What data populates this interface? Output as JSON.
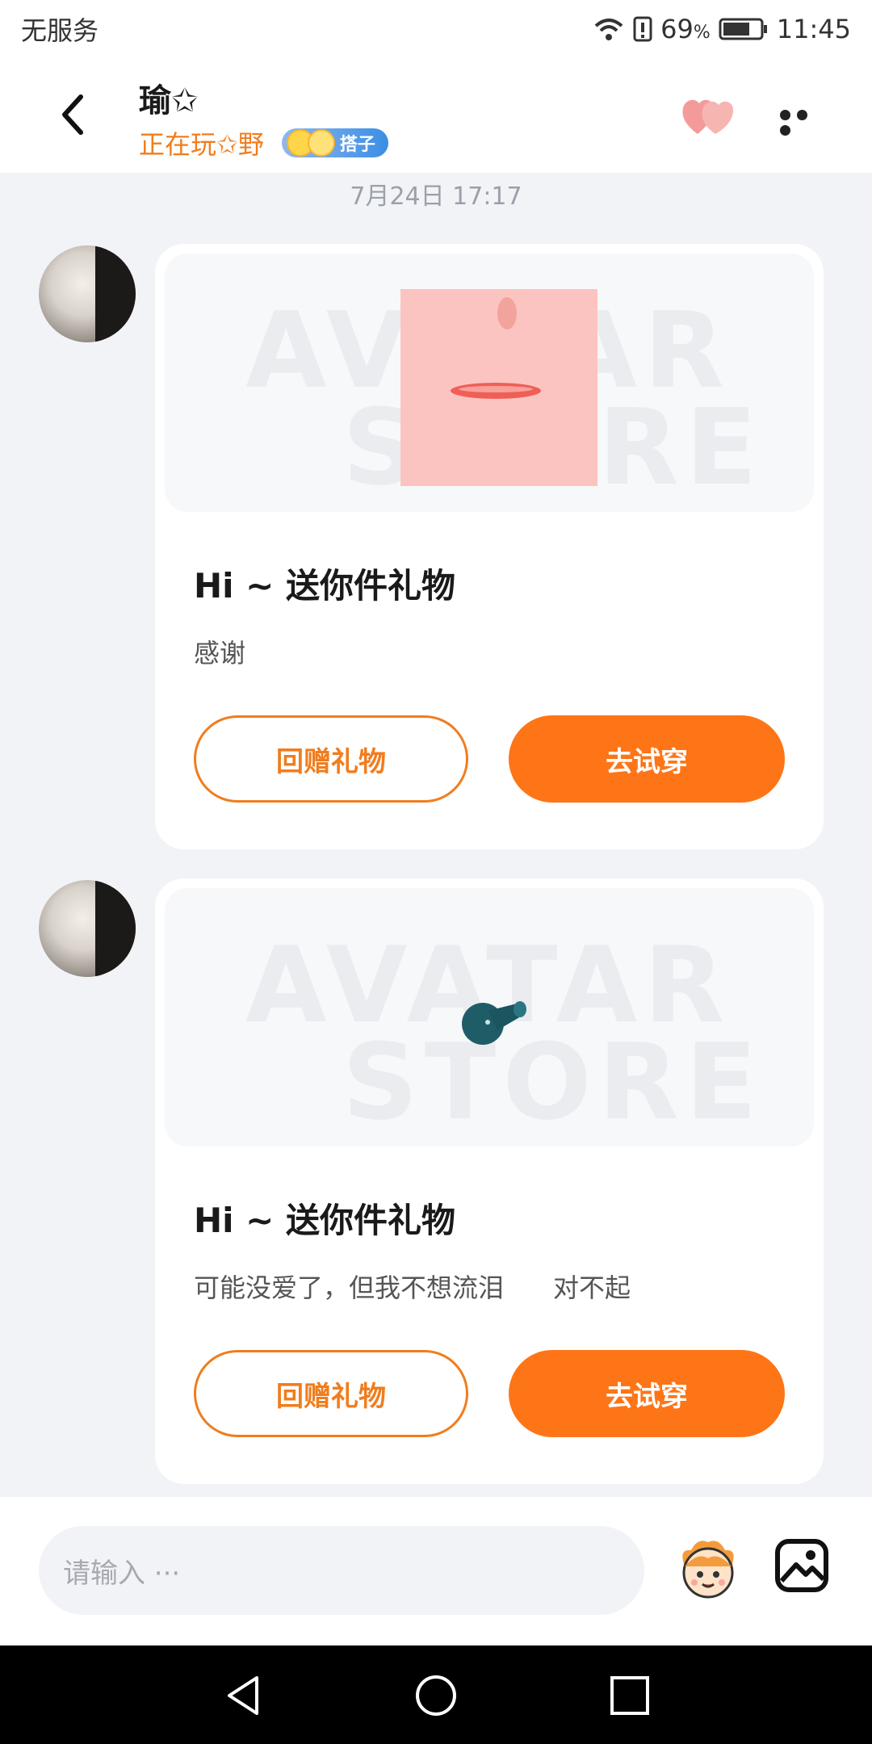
{
  "status_bar": {
    "carrier": "无服务",
    "battery": "69",
    "time": "11:45"
  },
  "header": {
    "contact_name": "瑜✩",
    "playing_status": "正在玩✩野",
    "tag_label": "搭子"
  },
  "chat": {
    "timestamp": "7月24日 17:17",
    "messages": [
      {
        "title": "Hi ~ 送你件礼物",
        "text": "感谢",
        "watermark_top": "AVATAR",
        "watermark_bottom": "STORE",
        "return_gift_label": "回赠礼物",
        "try_on_label": "去试穿"
      },
      {
        "title": "Hi ~ 送你件礼物",
        "text": "可能没爱了，但我不想流泪      对不起",
        "watermark_top": "AVATAR",
        "watermark_bottom": "STORE",
        "return_gift_label": "回赠礼物",
        "try_on_label": "去试穿"
      }
    ]
  },
  "input": {
    "placeholder": "请输入 ···"
  },
  "colors": {
    "accent": "#fd7517",
    "accent_outline": "#f07d1e",
    "background": "#f2f3f7"
  },
  "icons": [
    "back-arrow-icon",
    "heart-icon",
    "more-icon",
    "mascot-icon",
    "image-icon",
    "nav-back-icon",
    "nav-home-icon",
    "nav-recents-icon"
  ]
}
